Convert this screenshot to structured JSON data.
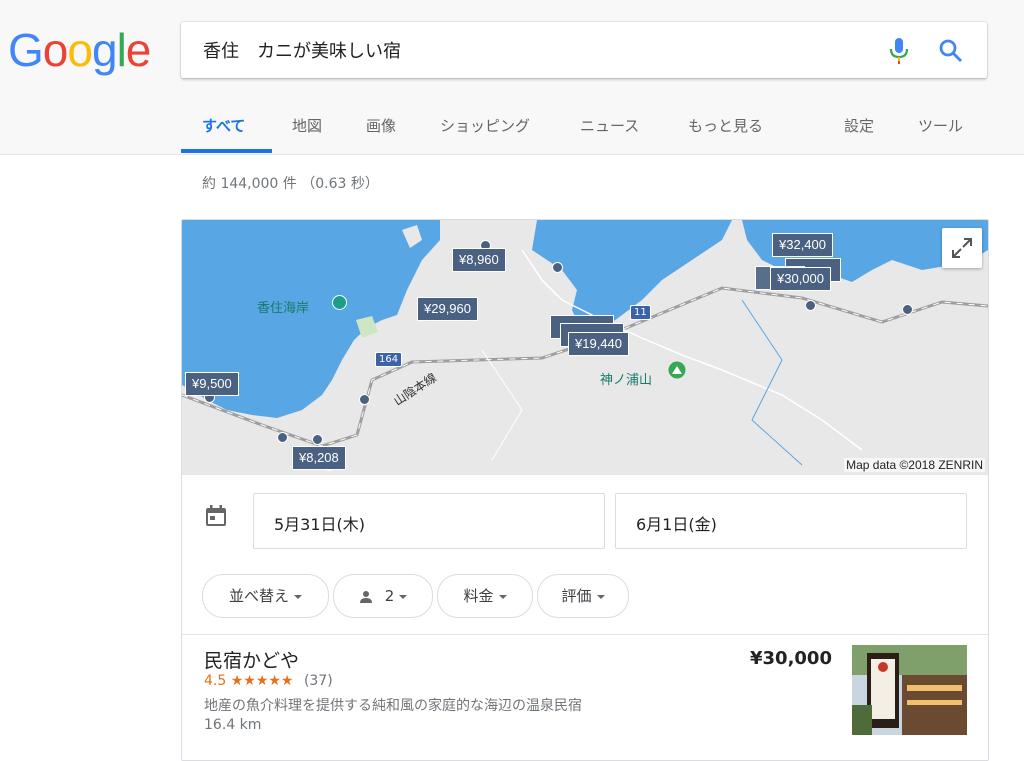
{
  "logo": {
    "letters": [
      "G",
      "o",
      "o",
      "g",
      "l",
      "e"
    ],
    "colors": [
      "#4285F4",
      "#EA4335",
      "#FBBC05",
      "#4285F4",
      "#34A853",
      "#EA4335"
    ]
  },
  "search": {
    "query": "香住　カニが美味しい宿"
  },
  "tabs": [
    {
      "label": "すべて",
      "active": true
    },
    {
      "label": "地図"
    },
    {
      "label": "画像"
    },
    {
      "label": "ショッピング"
    },
    {
      "label": "ニュース"
    },
    {
      "label": "もっと見る"
    },
    {
      "label": "設定"
    },
    {
      "label": "ツール"
    }
  ],
  "result_stats": "約 144,000 件 （0.63 秒）",
  "map": {
    "pins": [
      "¥8,960",
      "¥29,960",
      "¥9,500",
      "¥8,208",
      "¥32,400",
      "¥30,000",
      "¥19,440"
    ],
    "places": [
      "香住海岸",
      "神ノ浦山"
    ],
    "rail_line": "山陰本線",
    "routes": [
      "164",
      "11"
    ],
    "attribution": "Map data ©2018 ZENRIN"
  },
  "dates": {
    "checkin": "5月31日(木)",
    "checkout": "6月1日(金)"
  },
  "filters": {
    "sort": "並べ替え",
    "guests": "2",
    "price": "料金",
    "rating": "評価"
  },
  "hotel": {
    "name": "民宿かどや",
    "price": "¥30,000",
    "rating": "4.5",
    "stars": "★★★★★",
    "review_count": "(37)",
    "description": "地産の魚介料理を提供する純和風の家庭的な海辺の温泉民宿",
    "distance": "16.4 km"
  },
  "colors": {
    "accent": "#1a73e8",
    "map_water": "#59a6e5",
    "map_land": "#e8e8e8",
    "pin": "#4a6181",
    "star": "#e7711b"
  }
}
